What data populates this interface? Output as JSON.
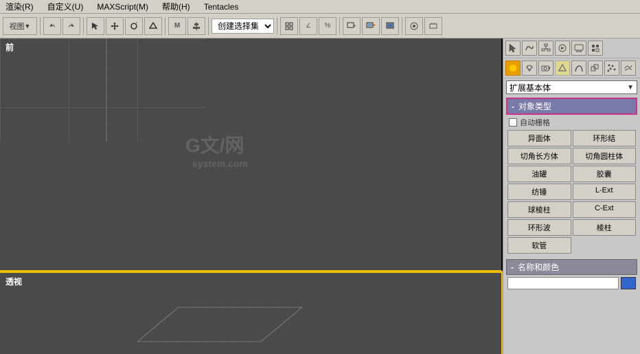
{
  "menubar": {
    "items": [
      "渲染(R)",
      "自定义(U)",
      "MAXScript(M)",
      "帮助(H)",
      "Tentacles"
    ]
  },
  "toolbar": {
    "dropdown": "创建选择集",
    "buttons": [
      "视图"
    ]
  },
  "right_panel": {
    "dropdown": "扩展基本体",
    "section_object_type": {
      "header": "对象类型",
      "auto_grid_label": "自动栅格",
      "buttons": [
        "异面体",
        "环形结",
        "切角长方体",
        "切角圆柱体",
        "油罐",
        "胶囊",
        "纺锤",
        "L-Ext",
        "球棱柱",
        "C-Ext",
        "环形波",
        "棱柱",
        "软管"
      ]
    },
    "section_name_color": {
      "header": "名称和颜色",
      "input_value": "",
      "input_placeholder": ""
    }
  },
  "viewports": {
    "top_label": "前",
    "bottom_label": "透视",
    "watermark": "G文/网\nsystem.com"
  },
  "icons": {
    "dropdown_arrow": "▼",
    "minus": "-",
    "section_minus": "-"
  }
}
